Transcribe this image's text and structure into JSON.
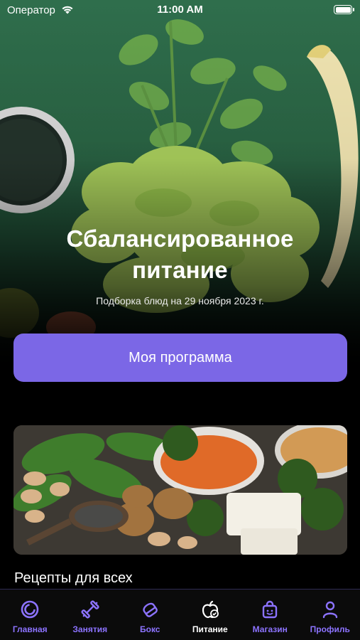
{
  "status_bar": {
    "carrier": "Оператор",
    "time": "11:00 AM"
  },
  "hero": {
    "title_line1": "Сбалансированное",
    "title_line2": "питание",
    "subtitle": "Подборка блюд на 29 ноября 2023 г.",
    "program_button": "Моя программа"
  },
  "section": {
    "title": "Рецепты для всех"
  },
  "tabs": [
    {
      "label": "Главная",
      "icon": "rings-icon",
      "active": false
    },
    {
      "label": "Занятия",
      "icon": "dumbbell-icon",
      "active": false
    },
    {
      "label": "Бокс",
      "icon": "boxing-glove-icon",
      "active": false
    },
    {
      "label": "Питание",
      "icon": "apple-icon",
      "active": true
    },
    {
      "label": "Магазин",
      "icon": "shopping-bag-icon",
      "active": false
    },
    {
      "label": "Профиль",
      "icon": "person-icon",
      "active": false
    }
  ],
  "colors": {
    "accent": "#7b67e6",
    "tab_inactive": "#8c73ff",
    "tab_active": "#ffffff"
  }
}
